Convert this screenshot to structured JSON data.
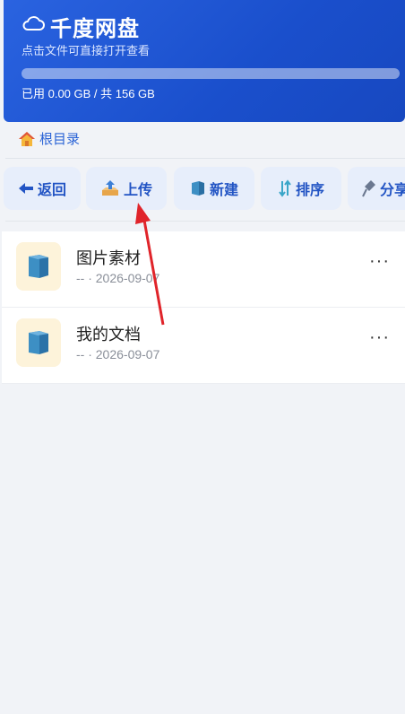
{
  "header": {
    "title": "千度网盘",
    "subtitle": "点击文件可直接打开查看",
    "storage_text": "已用 0.00 GB / 共 156 GB",
    "used_fraction": 0
  },
  "breadcrumb": {
    "label": "根目录"
  },
  "toolbar": {
    "back_label": "返回",
    "upload_label": "上传",
    "new_label": "新建",
    "sort_label": "排序",
    "share_label": "分享"
  },
  "files": [
    {
      "name": "图片素材",
      "meta": "-- · 2026-09-07"
    },
    {
      "name": "我的文档",
      "meta": "-- · 2026-09-07"
    }
  ],
  "more_label": "···",
  "colors": {
    "header_blue": "#1a4fcc",
    "accent": "#2254c4",
    "button_bg": "#e7eefb",
    "folder_tile": "#fdf3da",
    "folder_icon": "#3d8fc4",
    "annotation": "#e0242a"
  }
}
